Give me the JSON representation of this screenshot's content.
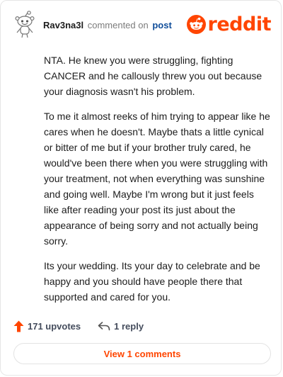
{
  "comment": {
    "username": "Rav3na3l",
    "meta_text": "commented on",
    "post_link": "post",
    "paragraphs": [
      "NTA. He knew you were struggling, fighting CANCER and he callously threw you out because your diagnosis wasn't his problem.",
      "To me it almost reeks of him trying to appear like he cares when he doesn't. Maybe thats a little cynical or bitter of me but if your brother truly cared, he would've been there when you were struggling with your treatment, not when everything was sunshine and going well. Maybe I'm wrong but it just feels like after reading your post its just about the appearance of being sorry and not actually being sorry.",
      "Its your wedding. Its your day to celebrate and be happy and you should have people there that supported and cared for you."
    ]
  },
  "brand": {
    "name": "reddit",
    "icon": "reddit-snoo-icon",
    "color": "#ff4500"
  },
  "actions": {
    "upvotes_label": "171 upvotes",
    "upvote_icon": "upvote-arrow-icon",
    "reply_label": "1 reply",
    "reply_icon": "reply-arrow-icon",
    "view_comments_label": "View 1 comments"
  },
  "colors": {
    "accent": "#ff4500",
    "link": "#0f4d9a",
    "muted": "#7c7c7c"
  }
}
